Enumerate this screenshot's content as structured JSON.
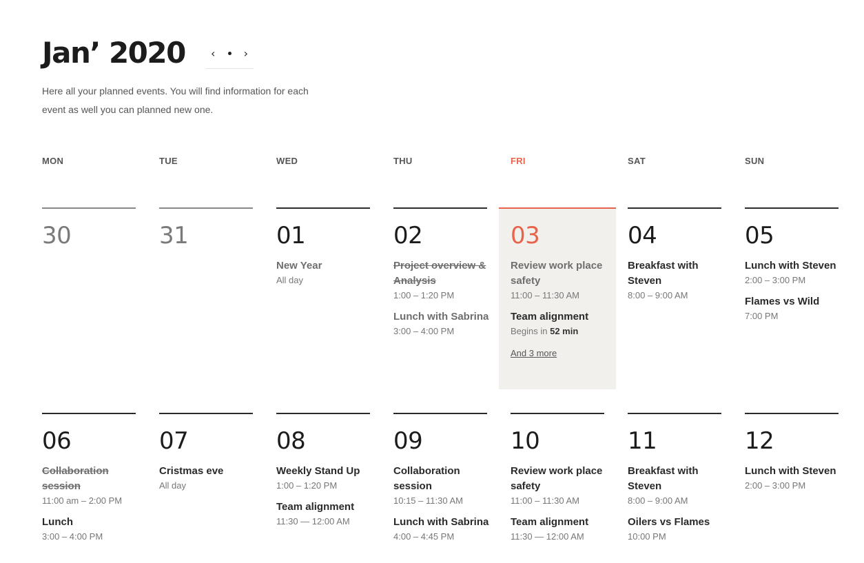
{
  "header": {
    "month_title": "Jan’ 2020",
    "prev_icon": "‹",
    "next_icon": "›",
    "subtitle": "Here all your planned events. You will find information for each event as well you can planned new one."
  },
  "colors": {
    "accent": "#e8634a",
    "today_bg": "#f1f0ec",
    "text": "#1f1f1f"
  },
  "weekdays": [
    "MON",
    "TUE",
    "WED",
    "THU",
    "FRI",
    "SAT",
    "SUN"
  ],
  "today_index": 4,
  "weeks": [
    {
      "days": [
        {
          "date": "30",
          "state": "past",
          "events": []
        },
        {
          "date": "31",
          "state": "past",
          "events": []
        },
        {
          "date": "01",
          "state": "normal",
          "events": [
            {
              "title": "New Year",
              "time": "All day",
              "style": "muted"
            }
          ]
        },
        {
          "date": "02",
          "state": "normal",
          "events": [
            {
              "title": "Project overview & Analysis",
              "time": "1:00 – 1:20 PM",
              "style": "strike"
            },
            {
              "title": "Lunch with Sabrina",
              "time": "3:00 – 4:00 PM",
              "style": "muted"
            }
          ]
        },
        {
          "date": "03",
          "state": "today",
          "events": [
            {
              "title": "Review work place safety",
              "time": "11:00 – 11:30 AM",
              "style": "muted"
            },
            {
              "title": "Team alignment",
              "time_prefix": "Begins in ",
              "time_strong": "52 min",
              "style": "normal"
            }
          ],
          "more": "And 3 more"
        },
        {
          "date": "04",
          "state": "normal",
          "events": [
            {
              "title": "Breakfast with Steven",
              "time": "8:00 – 9:00 AM",
              "style": "normal"
            }
          ]
        },
        {
          "date": "05",
          "state": "normal",
          "events": [
            {
              "title": "Lunch with Steven",
              "time": "2:00 – 3:00 PM",
              "style": "normal"
            },
            {
              "title": "Flames vs Wild",
              "time": "7:00 PM",
              "style": "normal"
            }
          ]
        }
      ]
    },
    {
      "days": [
        {
          "date": "06",
          "state": "normal",
          "events": [
            {
              "title": "Collaboration session",
              "time": "11:00 am – 2:00 PM",
              "style": "strike"
            },
            {
              "title": "Lunch",
              "time": "3:00 – 4:00 PM",
              "style": "normal"
            }
          ]
        },
        {
          "date": "07",
          "state": "normal",
          "events": [
            {
              "title": "Cristmas eve",
              "time": "All day",
              "style": "normal"
            }
          ]
        },
        {
          "date": "08",
          "state": "normal",
          "events": [
            {
              "title": "Weekly Stand Up",
              "time": "1:00 – 1:20 PM",
              "style": "normal"
            },
            {
              "title": "Team alignment",
              "time": "11:30 — 12:00 AM",
              "style": "normal"
            }
          ]
        },
        {
          "date": "09",
          "state": "normal",
          "events": [
            {
              "title": "Collaboration session",
              "time": "10:15 – 11:30 AM",
              "style": "normal"
            },
            {
              "title": "Lunch with Sabrina",
              "time": "4:00 – 4:45 PM",
              "style": "normal"
            }
          ]
        },
        {
          "date": "10",
          "state": "normal",
          "events": [
            {
              "title": "Review work place safety",
              "time": "11:00 – 11:30 AM",
              "style": "normal"
            },
            {
              "title": "Team alignment",
              "time": "11:30 — 12:00 AM",
              "style": "normal"
            }
          ]
        },
        {
          "date": "11",
          "state": "normal",
          "events": [
            {
              "title": "Breakfast with Steven",
              "time": "8:00 – 9:00 AM",
              "style": "normal"
            },
            {
              "title": "Oilers vs Flames",
              "time": "10:00 PM",
              "style": "normal"
            }
          ]
        },
        {
          "date": "12",
          "state": "normal",
          "events": [
            {
              "title": "Lunch with Steven",
              "time": "2:00 – 3:00 PM",
              "style": "normal"
            }
          ]
        }
      ]
    }
  ]
}
